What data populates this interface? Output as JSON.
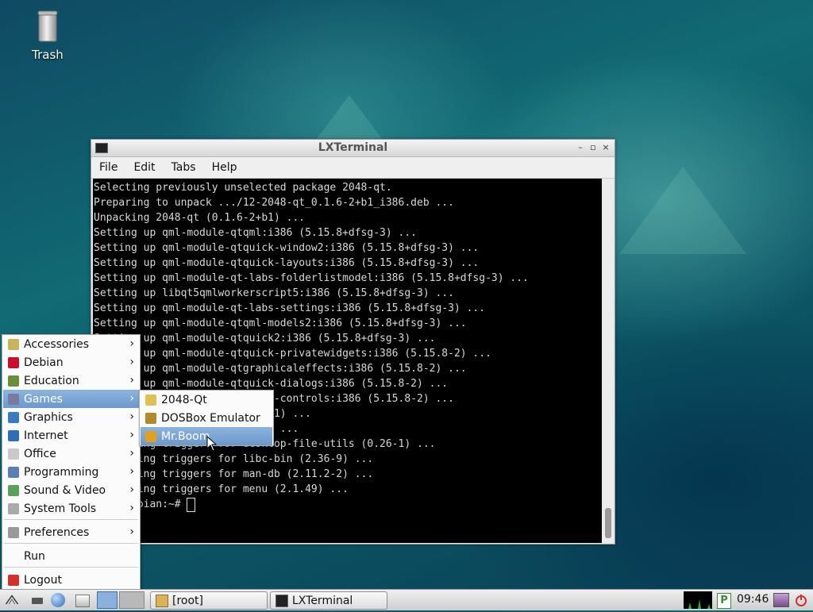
{
  "desktop": {
    "icons": [
      {
        "label": "Trash",
        "icon": "trash-icon"
      }
    ]
  },
  "window": {
    "title": "LXTerminal",
    "menu": [
      "File",
      "Edit",
      "Tabs",
      "Help"
    ],
    "terminal_lines": [
      "Selecting previously unselected package 2048-qt.",
      "Preparing to unpack .../12-2048-qt_0.1.6-2+b1_i386.deb ...",
      "Unpacking 2048-qt (0.1.6-2+b1) ...",
      "Setting up qml-module-qtqml:i386 (5.15.8+dfsg-3) ...",
      "Setting up qml-module-qtquick-window2:i386 (5.15.8+dfsg-3) ...",
      "Setting up qml-module-qtquick-layouts:i386 (5.15.8+dfsg-3) ...",
      "Setting up qml-module-qt-labs-folderlistmodel:i386 (5.15.8+dfsg-3) ...",
      "Setting up libqt5qmlworkerscript5:i386 (5.15.8+dfsg-3) ...",
      "Setting up qml-module-qt-labs-settings:i386 (5.15.8+dfsg-3) ...",
      "Setting up qml-module-qtqml-models2:i386 (5.15.8+dfsg-3) ...",
      "Setting up qml-module-qtquick2:i386 (5.15.8+dfsg-3) ...",
      "Setting up qml-module-qtquick-privatewidgets:i386 (5.15.8-2) ...",
      "Setting up qml-module-qtgraphicaleffects:i386 (5.15.8-2) ...",
      "Setting up qml-module-qtquick-dialogs:i386 (5.15.8-2) ...",
      "Setting up qml-module-qtquick-controls:i386 (5.15.8-2) ...",
      "Setting up 2048-qt (0.1.6-2+b1) ...",
      "Setting up libcap (3.70+nmu1) ...",
      "Processing triggers for desktop-file-utils (0.26-1) ...",
      "Processing triggers for libc-bin (2.36-9) ...",
      "Processing triggers for man-db (2.11.2-2) ...",
      "Processing triggers for menu (2.1.49) ..."
    ],
    "prompt": "root@debian:~# "
  },
  "start_menu": {
    "items": [
      {
        "label": "Accessories",
        "icon": "accessories-icon",
        "color": "#c8b45a",
        "submenu": true
      },
      {
        "label": "Debian",
        "icon": "debian-icon",
        "color": "#c8102e",
        "submenu": true
      },
      {
        "label": "Education",
        "icon": "education-icon",
        "color": "#6b8e3a",
        "submenu": true
      },
      {
        "label": "Games",
        "icon": "games-icon",
        "color": "#7a7aa0",
        "submenu": true,
        "selected": true
      },
      {
        "label": "Graphics",
        "icon": "graphics-icon",
        "color": "#3a7abf",
        "submenu": true
      },
      {
        "label": "Internet",
        "icon": "internet-icon",
        "color": "#2f6db5",
        "submenu": true
      },
      {
        "label": "Office",
        "icon": "office-icon",
        "color": "#c9c9c9",
        "submenu": true
      },
      {
        "label": "Programming",
        "icon": "programming-icon",
        "color": "#5a7fb0",
        "submenu": true
      },
      {
        "label": "Sound & Video",
        "icon": "sound-video-icon",
        "color": "#5aa05a",
        "submenu": true
      },
      {
        "label": "System Tools",
        "icon": "system-tools-icon",
        "color": "#aaaaaa",
        "submenu": true
      },
      {
        "label": "Preferences",
        "icon": "preferences-icon",
        "color": "#999999",
        "submenu": true
      },
      {
        "label": "Run",
        "icon": "",
        "color": "",
        "submenu": false
      },
      {
        "label": "Logout",
        "icon": "logout-icon",
        "color": "#d0312d",
        "submenu": false
      }
    ]
  },
  "games_submenu": {
    "items": [
      {
        "label": "2048-Qt",
        "icon": "2048-qt-icon",
        "color": "#e0c050"
      },
      {
        "label": "DOSBox Emulator",
        "icon": "dosbox-icon",
        "color": "#b08a2a"
      },
      {
        "label": "Mr.Boom",
        "icon": "mr-boom-icon",
        "color": "#e0a020",
        "selected": true
      }
    ]
  },
  "taskbar": {
    "tasks": [
      {
        "label": "[root]",
        "icon": "folder-icon"
      },
      {
        "label": "LXTerminal",
        "icon": "terminal-icon"
      }
    ],
    "clock": "09:46"
  }
}
